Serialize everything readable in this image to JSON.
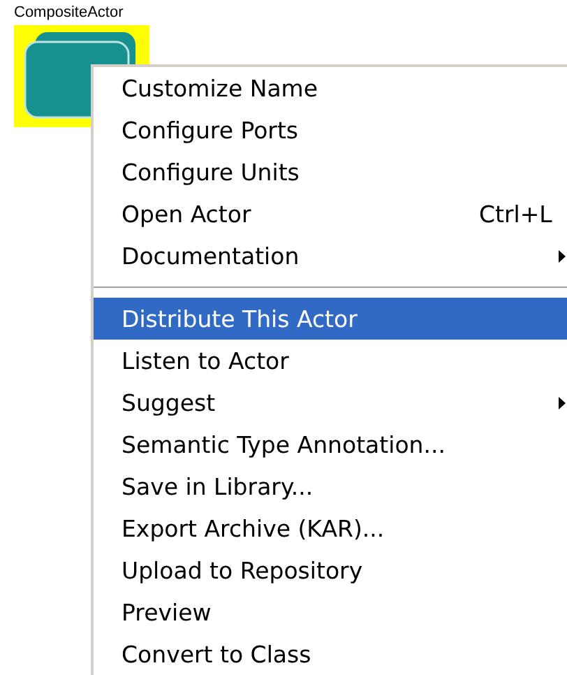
{
  "actor": {
    "label": "CompositeActor",
    "selected": true
  },
  "context_menu": {
    "items": [
      {
        "kind": "item",
        "label": "Customize Name",
        "selected": false
      },
      {
        "kind": "item",
        "label": "Configure Ports",
        "selected": false
      },
      {
        "kind": "item",
        "label": "Configure Units",
        "selected": false
      },
      {
        "kind": "item",
        "label": "Open Actor",
        "shortcut": "Ctrl+L",
        "selected": false
      },
      {
        "kind": "submenu",
        "label": "Documentation",
        "selected": false
      },
      {
        "kind": "separator"
      },
      {
        "kind": "item",
        "label": "Distribute This Actor",
        "selected": true
      },
      {
        "kind": "item",
        "label": "Listen to Actor",
        "selected": false
      },
      {
        "kind": "submenu",
        "label": "Suggest",
        "selected": false
      },
      {
        "kind": "item",
        "label": "Semantic Type Annotation...",
        "selected": false
      },
      {
        "kind": "item",
        "label": "Save in Library...",
        "selected": false
      },
      {
        "kind": "item",
        "label": "Export Archive (KAR)...",
        "selected": false
      },
      {
        "kind": "item",
        "label": "Upload to Repository",
        "selected": false
      },
      {
        "kind": "item",
        "label": "Preview",
        "selected": false
      },
      {
        "kind": "item",
        "label": "Convert to Class",
        "selected": false
      }
    ]
  }
}
